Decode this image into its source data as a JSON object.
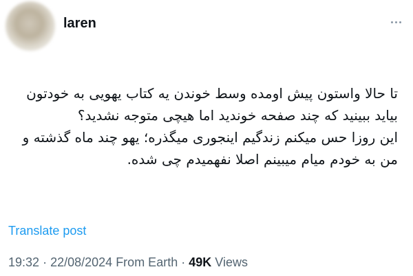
{
  "post": {
    "username": "laren",
    "more_icon": "more-horizontal-icon",
    "text_lines": [
      "تا حالا واستون پیش اومده وسط خوندن یه کتاب یهویی به خودتون بیاید ببینید که چند صفحه خوندید اما هیچی متوجه نشدید؟",
      "این روزا حس میکنم زندگیم اینجوری میگذره؛ یهو چند ماه گذشته و من به خودم میام میبینم اصلا نفهمیدم چی شده."
    ],
    "translate_label": "Translate post",
    "time": "19:32",
    "date": "22/08/2024",
    "source": "From Earth",
    "views_count": "49K",
    "views_label": "Views",
    "separator": "·"
  }
}
